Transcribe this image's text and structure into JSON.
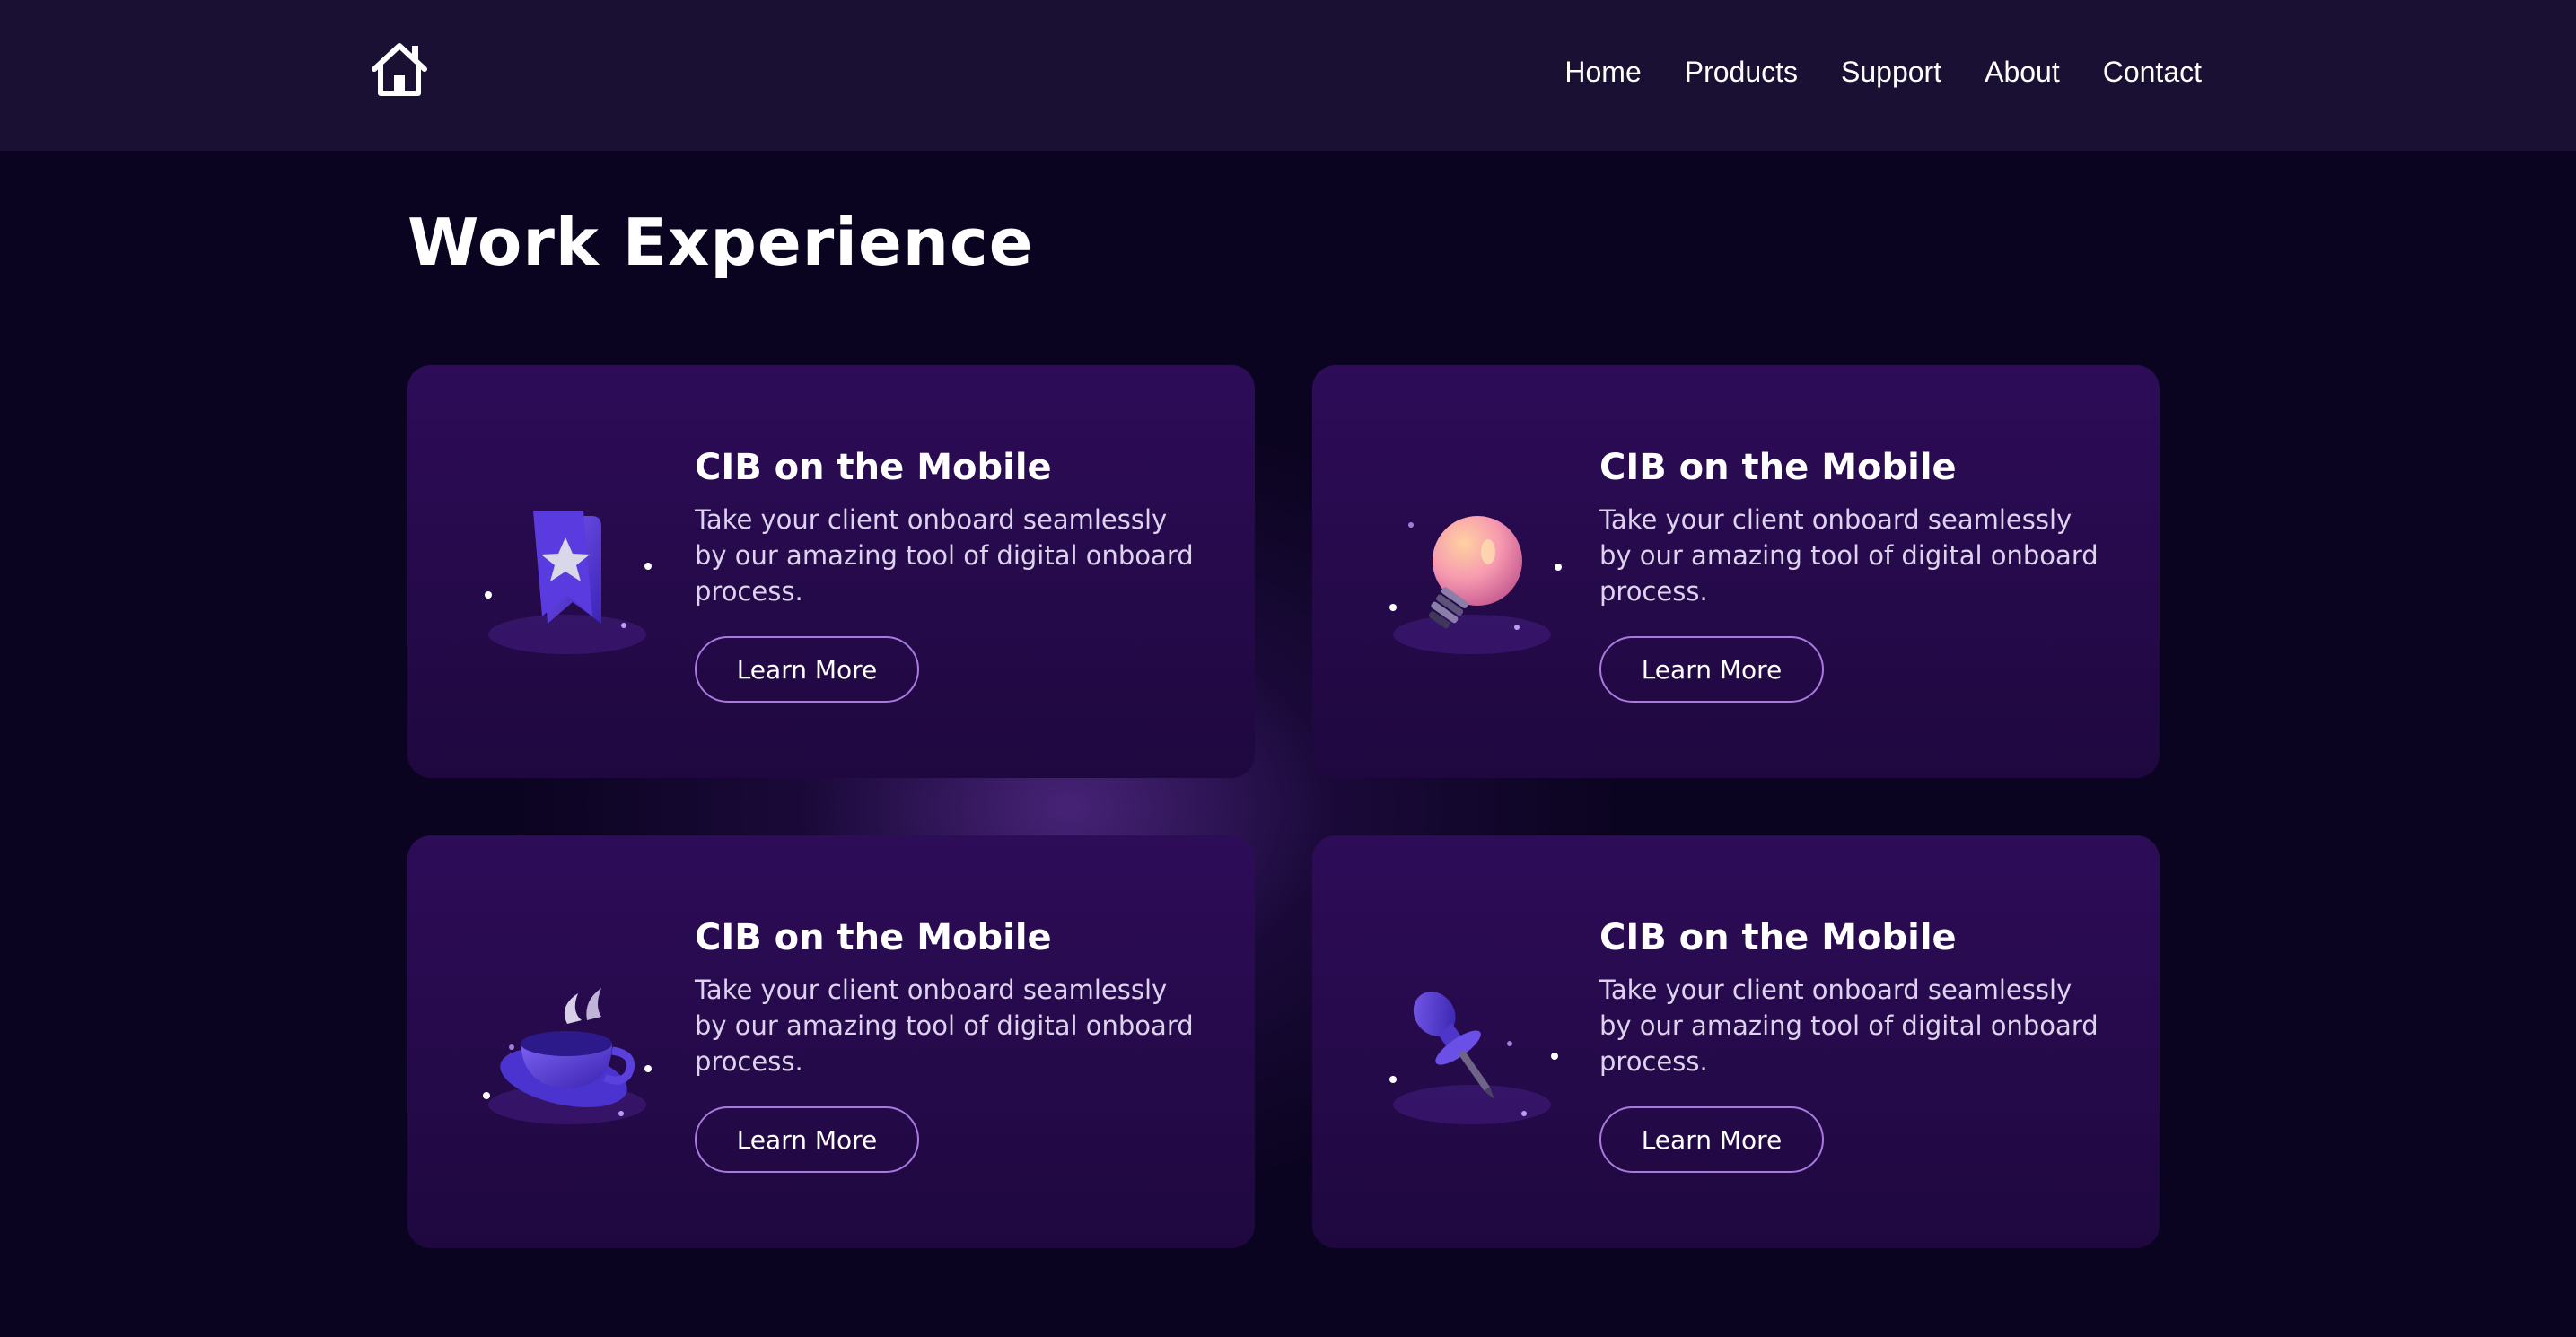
{
  "nav": {
    "logo_icon": "home-icon",
    "links": [
      "Home",
      "Products",
      "Support",
      "About",
      "Contact"
    ]
  },
  "main": {
    "title": "Work Experience",
    "cards": [
      {
        "icon": "bookmark-star-icon",
        "title": "CIB on the Mobile",
        "description": "Take your client onboard seamlessly by our amazing tool of digital onboard process.",
        "button_label": "Learn More"
      },
      {
        "icon": "lightbulb-icon",
        "title": "CIB on the Mobile",
        "description": "Take your client onboard seamlessly by our amazing tool of digital onboard process.",
        "button_label": "Learn More"
      },
      {
        "icon": "coffee-cup-icon",
        "title": "CIB on the Mobile",
        "description": "Take your client onboard seamlessly by our amazing tool of digital onboard process.",
        "button_label": "Learn More"
      },
      {
        "icon": "pin-icon",
        "title": "CIB on the Mobile",
        "description": "Take your client onboard seamlessly by our amazing tool of digital onboard process.",
        "button_label": "Learn More"
      }
    ]
  },
  "colors": {
    "background": "#0b0420",
    "header": "#1a1034",
    "card": "#2d0c58",
    "button_border": "#a87ae0"
  }
}
